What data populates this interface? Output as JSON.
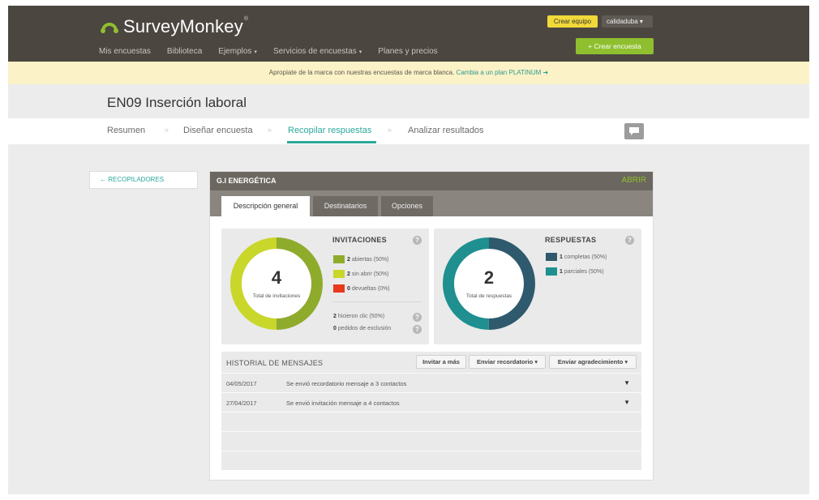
{
  "header": {
    "logo_text": "SurveyMonkey",
    "logo_mark": "®",
    "nav": [
      {
        "label": "Mis encuestas",
        "caret": ""
      },
      {
        "label": "Biblioteca",
        "caret": ""
      },
      {
        "label": "Ejemplos",
        "caret": "▾"
      },
      {
        "label": "Servicios de encuestas",
        "caret": "▾"
      },
      {
        "label": "Planes y precios",
        "caret": ""
      }
    ],
    "create_team": "Crear equipo",
    "user": "calidaduba ▾",
    "create_survey": "+ Crear encuesta"
  },
  "promo": {
    "text": "Apropiate de la marca con nuestras encuestas de marca blanca.",
    "link": "Cambia a un plan PLATINUM ➜"
  },
  "survey": {
    "title": "EN09 Inserción laboral"
  },
  "tabs": [
    {
      "label": "Resumen"
    },
    {
      "label": "Diseñar encuesta"
    },
    {
      "label": "Recopilar respuestas"
    },
    {
      "label": "Analizar resultados"
    }
  ],
  "tab_separator": "»",
  "back": {
    "label": "← RECOPILADORES"
  },
  "collector": {
    "name": "G.I ENERGÉTICA",
    "status": "ABRIR",
    "subtabs": [
      "Descripción general",
      "Destinatarios",
      "Opciones"
    ]
  },
  "invitations": {
    "title": "INVITACIONES",
    "total": "4",
    "caption": "Total de invitaciones",
    "help": "?",
    "legend": [
      {
        "count": "2",
        "label": "abiertas (50%)",
        "color": "#8fab2c"
      },
      {
        "count": "2",
        "label": "sin abrir (50%)",
        "color": "#c9d62a"
      },
      {
        "count": "0",
        "label": "devueltas (0%)",
        "color": "#e8391c"
      }
    ],
    "extra": [
      {
        "count": "2",
        "label": "hicieron clic (50%)"
      },
      {
        "count": "0",
        "label": "pedidos de exclusión"
      }
    ],
    "fractions": [
      0.5,
      0.5
    ]
  },
  "responses": {
    "title": "RESPUESTAS",
    "total": "2",
    "caption": "Total de respuestas",
    "help": "?",
    "legend": [
      {
        "count": "1",
        "label": "completas (50%)",
        "color": "#2f5a6e"
      },
      {
        "count": "1",
        "label": "parciales (50%)",
        "color": "#1f8f8f"
      }
    ],
    "fractions": [
      0.5,
      0.5
    ]
  },
  "history": {
    "title": "HISTORIAL DE MENSAJES",
    "buttons": [
      "Invitar a más",
      "Enviar recordatorio ▾",
      "Enviar agradecimiento ▾"
    ],
    "rows": [
      {
        "date": "04/05/2017",
        "message": "Se envió recordatorio mensaje a 3 contactos",
        "arrow": "▼"
      },
      {
        "date": "27/04/2017",
        "message": "Se envió invitación mensaje a 4 contactos",
        "arrow": "▼"
      }
    ]
  }
}
